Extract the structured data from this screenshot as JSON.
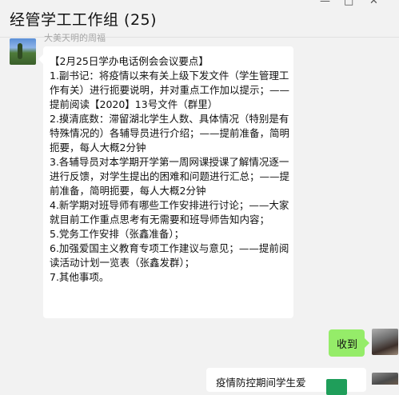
{
  "header": {
    "title": "经管学工工作组 (25)",
    "minimize_glyph": "—",
    "maximize_glyph": "□",
    "close_glyph": "✕"
  },
  "messages": [
    {
      "sender": "大美天明的周福",
      "text": "【2月25日学办电话例会会议要点】\n1.副书记：将疫情以来有关上级下发文件（学生管理工作有关）进行扼要说明，并对重点工作加以提示；——提前阅读【2020】13号文件（群里）\n2.摸清底数：滞留湖北学生人数、具体情况（特别是有特殊情况的）各辅导员进行介绍；——提前准备，简明扼要，每人大概2分钟\n3.各辅导员对本学期开学第一周网课授课了解情况逐一进行反馈，对学生提出的困难和问题进行汇总；——提前准备，简明扼要，每人大概2分钟\n4.新学期对班导师有哪些工作安排进行讨论；——大家就目前工作重点思考有无需要和班导师告知内容；\n5.党务工作安排（张鑫准备）；\n6.加强爱国主义教育专项工作建议与意见；——提前阅读活动计划一览表（张鑫发群）；\n7.其他事项。"
    },
    {
      "text": "收到"
    },
    {
      "card_title": "疫情防控期间学生爱"
    }
  ],
  "colors": {
    "background": "#f2f2f2",
    "bubble_incoming": "#ffffff",
    "bubble_outgoing": "#95ec69",
    "file_icon": "#1f9e5a"
  }
}
